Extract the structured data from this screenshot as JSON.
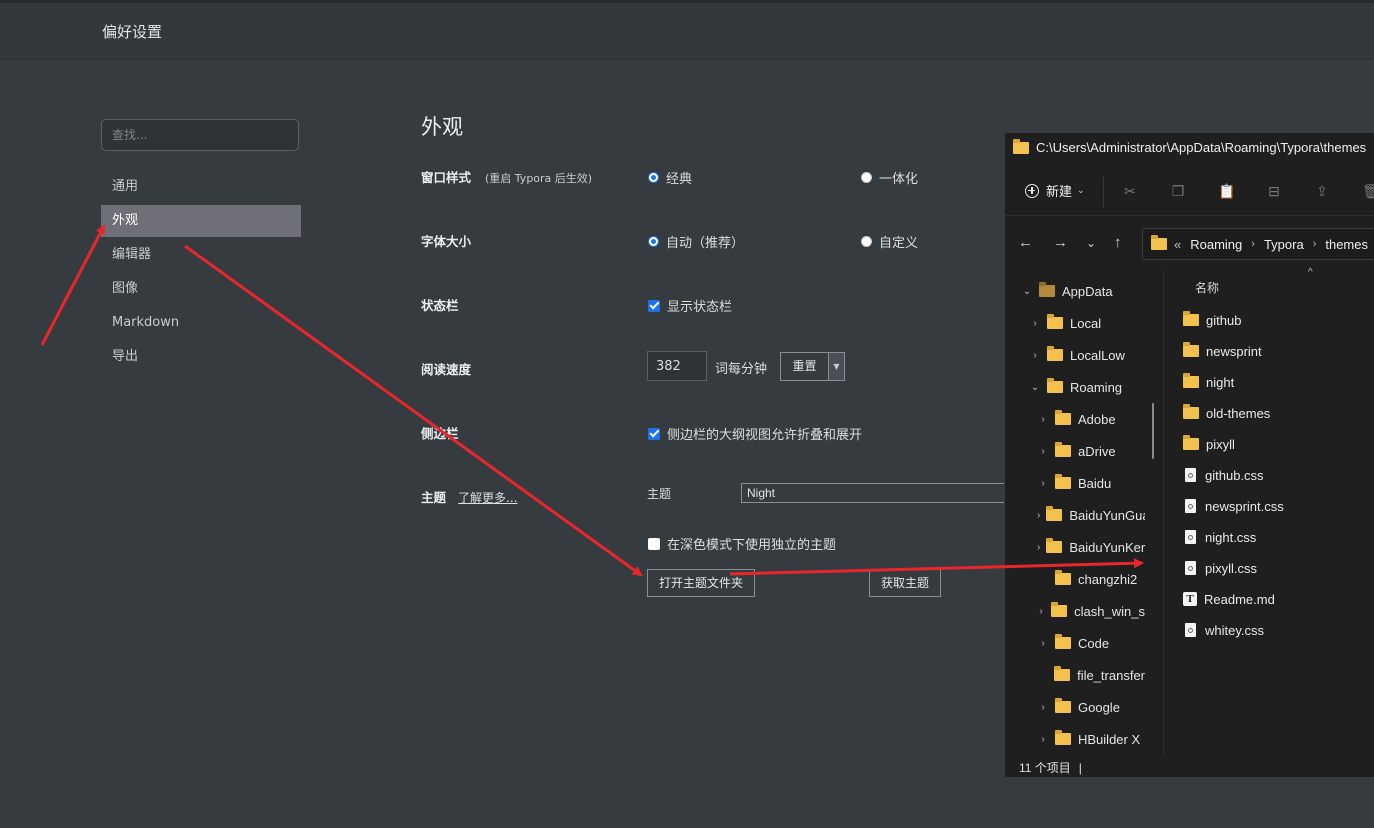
{
  "header": {
    "title": "偏好设置"
  },
  "sidebar": {
    "search_placeholder": "查找...",
    "items": [
      {
        "label": "通用"
      },
      {
        "label": "外观"
      },
      {
        "label": "编辑器"
      },
      {
        "label": "图像"
      },
      {
        "label": "Markdown"
      },
      {
        "label": "导出"
      }
    ]
  },
  "appearance": {
    "title": "外观",
    "window_style": {
      "label": "窗口样式",
      "note": "(重启 Typora 后生效)",
      "option_classic": "经典",
      "option_unified": "一体化",
      "selected": "经典"
    },
    "font_size": {
      "label": "字体大小",
      "option_auto": "自动（推荐）",
      "option_custom": "自定义",
      "selected": "自动（推荐）"
    },
    "status_bar": {
      "label": "状态栏",
      "checkbox_label": "显示状态栏",
      "checked": true
    },
    "reading_speed": {
      "label": "阅读速度",
      "value": "382",
      "unit": "词每分钟",
      "reset_label": "重置"
    },
    "sidebar": {
      "label": "侧边栏",
      "checkbox_label": "侧边栏的大纲视图允许折叠和展开",
      "checked": true
    },
    "theme": {
      "label": "主题",
      "learn_more": "了解更多...",
      "theme_label": "主题",
      "selected": "Night",
      "dark_mode_label": "在深色模式下使用独立的主题",
      "dark_mode_checked": false,
      "open_folder_label": "打开主题文件夹",
      "get_themes_label": "获取主题"
    }
  },
  "explorer": {
    "title": "C:\\Users\\Administrator\\AppData\\Roaming\\Typora\\themes",
    "new_label": "新建",
    "breadcrumb": {
      "overflow": "«",
      "items": [
        "Roaming",
        "Typora",
        "themes"
      ]
    },
    "tree": [
      {
        "label": "AppData",
        "expanded": true
      },
      {
        "label": "Local"
      },
      {
        "label": "LocalLow"
      },
      {
        "label": "Roaming",
        "expanded": true
      },
      {
        "label": "Adobe"
      },
      {
        "label": "aDrive"
      },
      {
        "label": "Baidu"
      },
      {
        "label": "BaiduYunGuanjia"
      },
      {
        "label": "BaiduYunKernel"
      },
      {
        "label": "changzhi2"
      },
      {
        "label": "clash_win_s"
      },
      {
        "label": "Code"
      },
      {
        "label": "file_transfer"
      },
      {
        "label": "Google"
      },
      {
        "label": "HBuilder X"
      }
    ],
    "column_name": "名称",
    "files": [
      {
        "name": "github",
        "kind": "folder"
      },
      {
        "name": "newsprint",
        "kind": "folder"
      },
      {
        "name": "night",
        "kind": "folder"
      },
      {
        "name": "old-themes",
        "kind": "folder"
      },
      {
        "name": "pixyll",
        "kind": "folder"
      },
      {
        "name": "github.css",
        "kind": "css"
      },
      {
        "name": "newsprint.css",
        "kind": "css"
      },
      {
        "name": "night.css",
        "kind": "css"
      },
      {
        "name": "pixyll.css",
        "kind": "css"
      },
      {
        "name": "Readme.md",
        "kind": "text"
      },
      {
        "name": "whitey.css",
        "kind": "css"
      }
    ],
    "status": "11 个项目"
  },
  "annotation_color": "#e8262c"
}
